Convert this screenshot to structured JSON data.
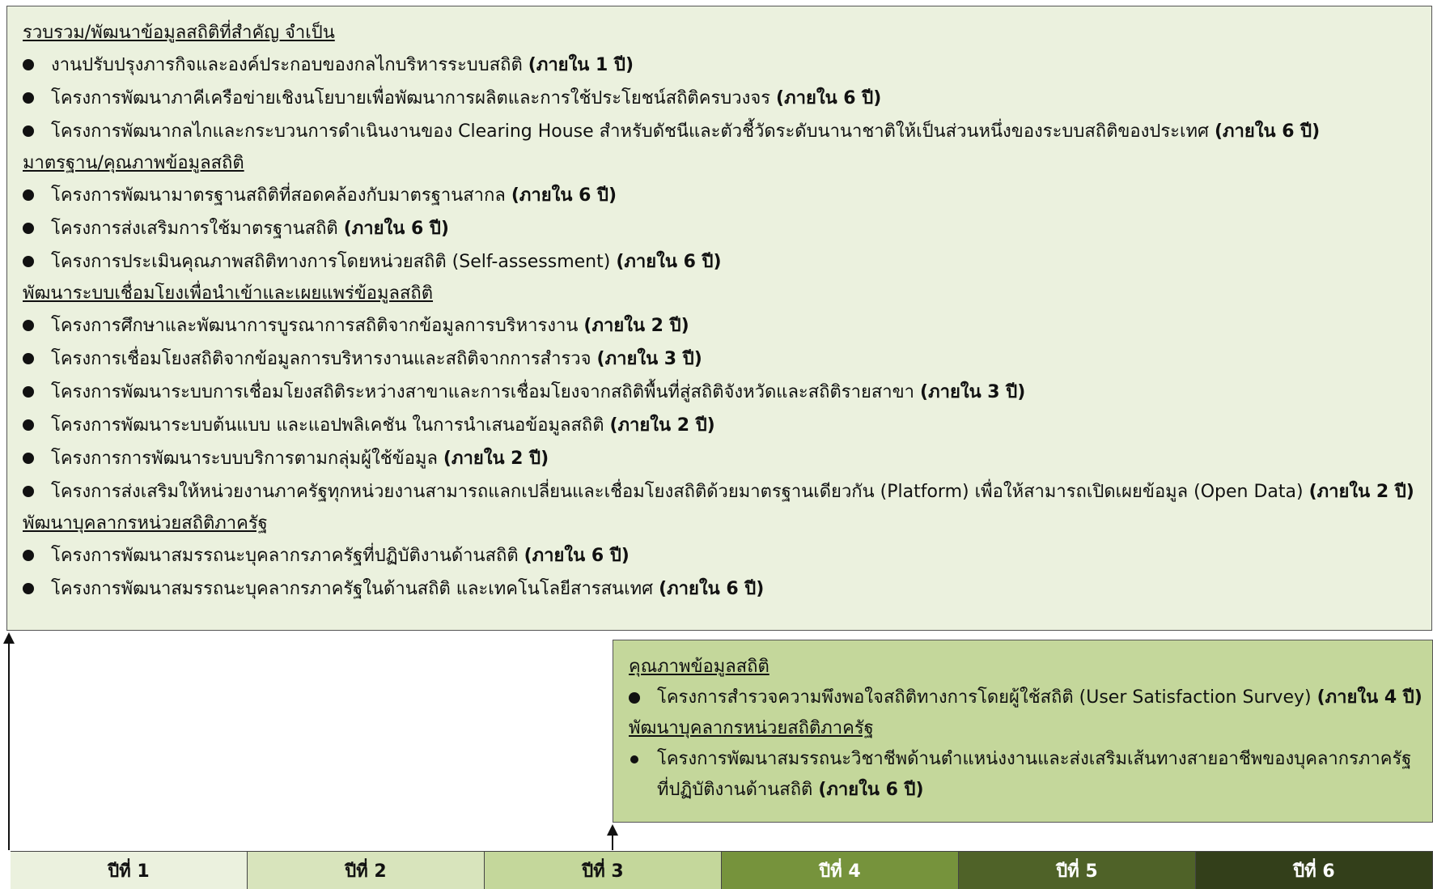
{
  "top": {
    "sections": [
      {
        "title": "รวบรวม/พัฒนาข้อมูลสถิติที่สำคัญ จำเป็น",
        "items": [
          {
            "text": "งานปรับปรุงภารกิจและองค์ประกอบของกลไกบริหารระบบสถิติ",
            "period": "(ภายใน 1 ปี)"
          },
          {
            "text": "โครงการพัฒนาภาคีเครือข่ายเชิงนโยบายเพื่อพัฒนาการผลิตและการใช้ประโยชน์สถิติครบวงจร",
            "period": "(ภายใน 6 ปี)"
          },
          {
            "text": "โครงการพัฒนากลไกและกระบวนการดำเนินงานของ Clearing House สำหรับดัชนีและตัวชี้วัดระดับนานาชาติให้เป็นส่วนหนึ่งของระบบสถิติของประเทศ",
            "period": "(ภายใน 6 ปี)"
          }
        ]
      },
      {
        "title": "มาตรฐาน/คุณภาพข้อมูลสถิติ",
        "items": [
          {
            "text": "โครงการพัฒนามาตรฐานสถิติที่สอดคล้องกับมาตรฐานสากล",
            "period": "(ภายใน 6 ปี)"
          },
          {
            "text": "โครงการส่งเสริมการใช้มาตรฐานสถิติ",
            "period": "(ภายใน 6 ปี)"
          },
          {
            "text": "โครงการประเมินคุณภาพสถิติทางการโดยหน่วยสถิติ (Self-assessment)",
            "period": "(ภายใน 6 ปี)"
          }
        ]
      },
      {
        "title": "พัฒนาระบบเชื่อมโยงเพื่อนำเข้าและเผยแพร่ข้อมูลสถิติ",
        "items": [
          {
            "text": "โครงการศึกษาและพัฒนาการบูรณาการสถิติจากข้อมูลการบริหารงาน ",
            "period": "(ภายใน 2 ปี)"
          },
          {
            "text": "โครงการเชื่อมโยงสถิติจากข้อมูลการบริหารงานและสถิติจากการสำรวจ",
            "period": "(ภายใน 3 ปี)"
          },
          {
            "text": "โครงการพัฒนาระบบการเชื่อมโยงสถิติระหว่างสาขาและการเชื่อมโยงจากสถิติพื้นที่สู่สถิติจังหวัดและสถิติรายสาขา",
            "period": "(ภายใน 3 ปี)"
          },
          {
            "text": "โครงการพัฒนาระบบต้นแบบ และแอปพลิเคชัน ในการนำเสนอข้อมูลสถิติ ",
            "period": "(ภายใน 2 ปี)"
          },
          {
            "text": "โครงการการพัฒนาระบบบริการตามกลุ่มผู้ใช้ข้อมูล",
            "period": "(ภายใน 2 ปี)"
          },
          {
            "text": "โครงการส่งเสริมให้หน่วยงานภาครัฐทุกหน่วยงานสามารถแลกเปลี่ยนและเชื่อมโยงสถิติด้วยมาตรฐานเดียวกัน (Platform) เพื่อให้สามารถเปิดเผยข้อมูล (Open Data)",
            "period": "(ภายใน 2 ปี)"
          }
        ]
      },
      {
        "title": "พัฒนาบุคลากรหน่วยสถิติภาครัฐ",
        "items": [
          {
            "text": "โครงการพัฒนาสมรรถนะบุคลากรภาครัฐที่ปฏิบัติงานด้านสถิติ",
            "period": "(ภายใน 6 ปี)"
          },
          {
            "text": "โครงการพัฒนาสมรรถนะบุคลากรภาครัฐในด้านสถิติ และเทคโนโลยีสารสนเทศ",
            "period": "(ภายใน 6 ปี)"
          }
        ]
      }
    ]
  },
  "right": {
    "section1_title": "คุณภาพข้อมูลสถิติ",
    "item1_text": "โครงการสำรวจความพึงพอใจสถิติทางการโดยผู้ใช้สถิติ (User Satisfaction Survey)",
    "item1_period": "(ภายใน 4 ปี)",
    "section2_title": "พัฒนาบุคลากรหน่วยสถิติภาครัฐ",
    "item2_text_line1": "โครงการพัฒนาสมรรถนะวิชาชีพด้านตำแหน่งงานและส่งเสริมเส้นทางสายอาชีพของบุคลากรภาครัฐ",
    "item2_text_line2": "ที่ปฏิบัติงานด้านสถิติ",
    "item2_period": "(ภายใน 6 ปี)"
  },
  "timeline": {
    "years": [
      {
        "label": "ปีที่ 1",
        "bg": "#ebf1de",
        "fg": "#111111"
      },
      {
        "label": "ปีที่ 2",
        "bg": "#d8e4bc",
        "fg": "#111111"
      },
      {
        "label": "ปีที่ 3",
        "bg": "#c4d79b",
        "fg": "#111111"
      },
      {
        "label": "ปีที่ 4",
        "bg": "#76933c",
        "fg": "#ffffff"
      },
      {
        "label": "ปีที่ 5",
        "bg": "#4f6228",
        "fg": "#ffffff"
      },
      {
        "label": "ปีที่ 6",
        "bg": "#333f1a",
        "fg": "#ffffff"
      }
    ]
  }
}
